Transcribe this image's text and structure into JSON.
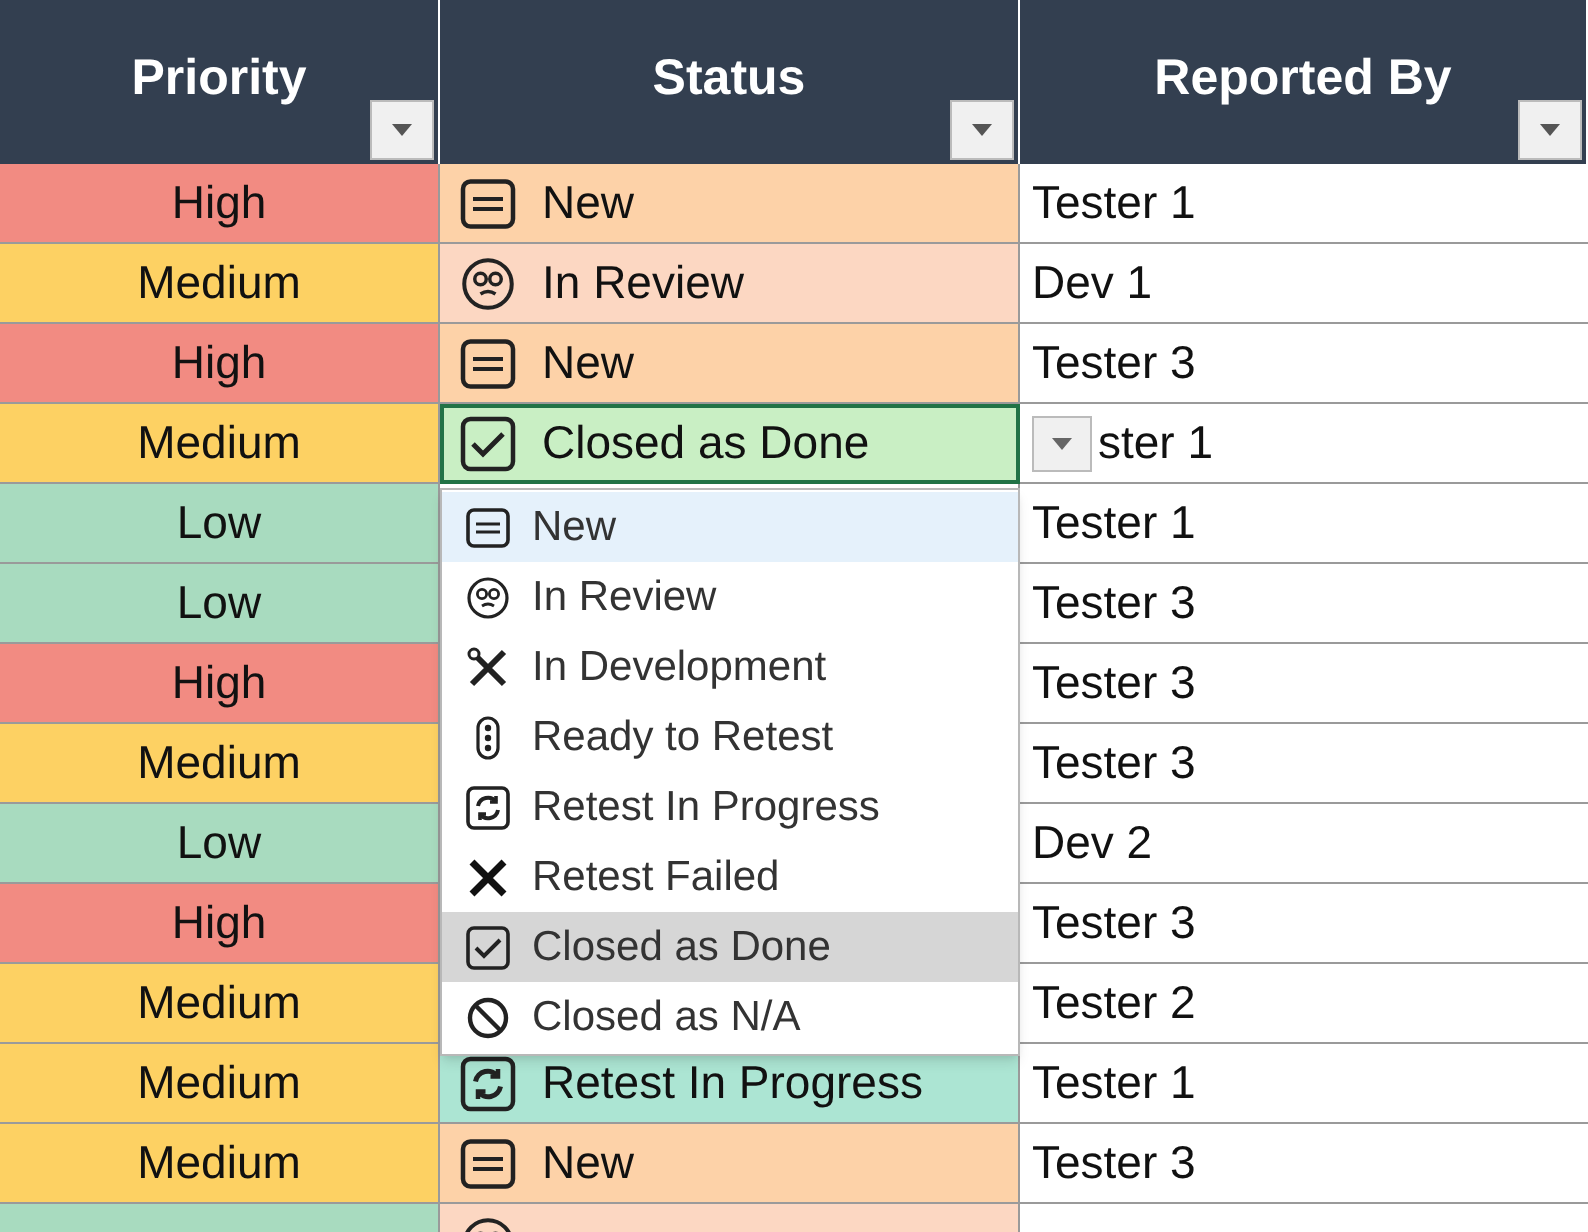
{
  "columns": [
    {
      "label": "Priority"
    },
    {
      "label": "Status"
    },
    {
      "label": "Reported By"
    }
  ],
  "rows": [
    {
      "priority": {
        "text": "High",
        "color": "#f28b82"
      },
      "status": {
        "text": "New",
        "kind": "new"
      },
      "reported_by": "Tester 1"
    },
    {
      "priority": {
        "text": "Medium",
        "color": "#fdd163"
      },
      "status": {
        "text": "In Review",
        "kind": "review"
      },
      "reported_by": "Dev 1"
    },
    {
      "priority": {
        "text": "High",
        "color": "#f28b82"
      },
      "status": {
        "text": "New",
        "kind": "new"
      },
      "reported_by": "Tester 3"
    },
    {
      "priority": {
        "text": "Medium",
        "color": "#fdd163"
      },
      "status": {
        "text": "Closed as Done",
        "kind": "done",
        "selected": true
      },
      "reported_by": "ster 1"
    },
    {
      "priority": {
        "text": "Low",
        "color": "#a8dbbf"
      },
      "reported_by": "Tester 1"
    },
    {
      "priority": {
        "text": "Low",
        "color": "#a8dbbf"
      },
      "reported_by": "Tester 3"
    },
    {
      "priority": {
        "text": "High",
        "color": "#f28b82"
      },
      "reported_by": "Tester 3"
    },
    {
      "priority": {
        "text": "Medium",
        "color": "#fdd163"
      },
      "reported_by": "Tester 3"
    },
    {
      "priority": {
        "text": "Low",
        "color": "#a8dbbf"
      },
      "reported_by": "Dev 2"
    },
    {
      "priority": {
        "text": "High",
        "color": "#f28b82"
      },
      "reported_by": "Tester 3"
    },
    {
      "priority": {
        "text": "Medium",
        "color": "#fdd163"
      },
      "reported_by": "Tester 2"
    },
    {
      "priority": {
        "text": "Medium",
        "color": "#fdd163"
      },
      "status": {
        "text": "Retest In Progress",
        "kind": "progress"
      },
      "reported_by": "Tester 1"
    },
    {
      "priority": {
        "text": "Medium",
        "color": "#fdd163"
      },
      "status": {
        "text": "New",
        "kind": "new"
      },
      "reported_by": "Tester 3"
    },
    {
      "priority": {
        "color": "#a8dbbf"
      },
      "status": {
        "kind": "review"
      }
    }
  ],
  "dropdown": {
    "items": [
      {
        "label": "New",
        "kind": "new",
        "highlighted": true,
        "selected": false
      },
      {
        "label": "In Review",
        "kind": "review",
        "highlighted": false,
        "selected": false
      },
      {
        "label": "In Development",
        "kind": "dev",
        "highlighted": false,
        "selected": false
      },
      {
        "label": "Ready to Retest",
        "kind": "ready",
        "highlighted": false,
        "selected": false
      },
      {
        "label": "Retest In Progress",
        "kind": "progress",
        "highlighted": false,
        "selected": false
      },
      {
        "label": "Retest Failed",
        "kind": "failed",
        "highlighted": false,
        "selected": false
      },
      {
        "label": "Closed as Done",
        "kind": "done",
        "highlighted": false,
        "selected": true
      },
      {
        "label": "Closed as N/A",
        "kind": "na",
        "highlighted": false,
        "selected": false
      }
    ]
  }
}
